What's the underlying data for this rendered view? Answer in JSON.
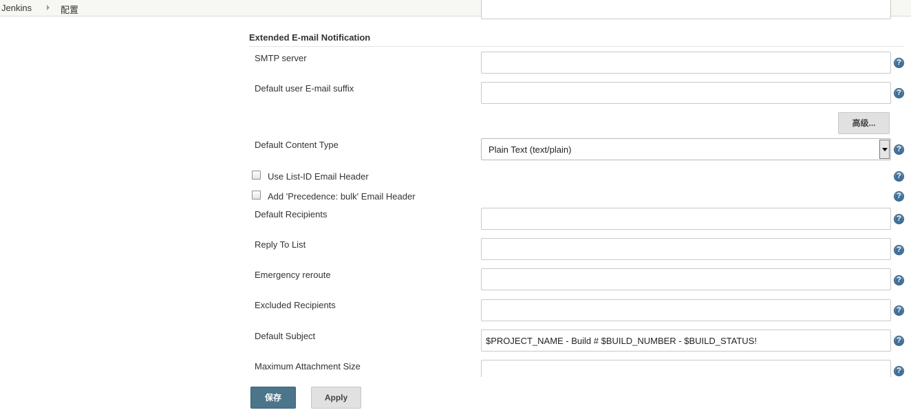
{
  "breadcrumb": {
    "root": "Jenkins",
    "current": "配置"
  },
  "section": {
    "title": "Extended E-mail Notification"
  },
  "fields": {
    "smtp_server": {
      "label": "SMTP server",
      "value": ""
    },
    "email_suffix": {
      "label": "Default user E-mail suffix",
      "value": ""
    },
    "advanced_button": "高级...",
    "content_type": {
      "label": "Default Content Type",
      "value": "Plain Text (text/plain)"
    },
    "list_id": {
      "label": "Use List-ID Email Header",
      "checked": false
    },
    "precedence": {
      "label": "Add 'Precedence: bulk' Email Header",
      "checked": false
    },
    "default_recipients": {
      "label": "Default Recipients",
      "value": ""
    },
    "reply_to": {
      "label": "Reply To List",
      "value": ""
    },
    "emergency_reroute": {
      "label": "Emergency reroute",
      "value": ""
    },
    "excluded_recipients": {
      "label": "Excluded Recipients",
      "value": ""
    },
    "default_subject": {
      "label": "Default Subject",
      "value": "$PROJECT_NAME - Build # $BUILD_NUMBER - $BUILD_STATUS!"
    },
    "max_attachment": {
      "label": "Maximum Attachment Size",
      "value": ""
    }
  },
  "help_glyph": "?",
  "buttons": {
    "save": "保存",
    "apply": "Apply"
  },
  "colors": {
    "primary_button": "#4b758b",
    "help_icon": "#3f6f98"
  }
}
